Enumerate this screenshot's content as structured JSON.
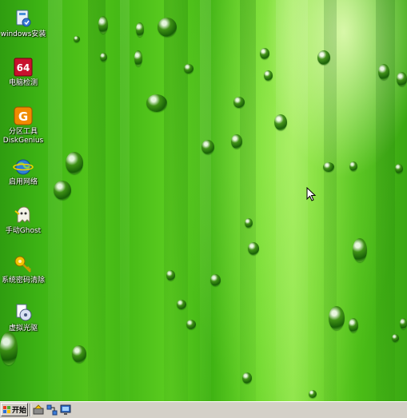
{
  "desktop": {
    "icons": [
      {
        "id": "windows-install",
        "label": "windows安装",
        "icon": "installer-icon"
      },
      {
        "id": "pc-check",
        "label": "电脑检测",
        "icon": "aida64-icon"
      },
      {
        "id": "partition-tool",
        "label": "分区工具",
        "label2": "DiskGenius",
        "icon": "diskgenius-icon"
      },
      {
        "id": "start-network",
        "label": "启用网络",
        "icon": "network-globe-icon"
      },
      {
        "id": "manual-ghost",
        "label": "手动Ghost",
        "icon": "ghost-icon"
      },
      {
        "id": "password-clear",
        "label": "系统密码清除",
        "icon": "key-icon"
      },
      {
        "id": "virtual-cd",
        "label": "虚拟光驱",
        "icon": "virtual-drive-icon"
      }
    ]
  },
  "taskbar": {
    "start_label": "开始",
    "quick_launch": [
      "launcher-icon",
      "network-icon",
      "monitor-icon"
    ]
  },
  "colors": {
    "wallpaper_base": "#52c41a",
    "taskbar": "#d4d0c8"
  }
}
